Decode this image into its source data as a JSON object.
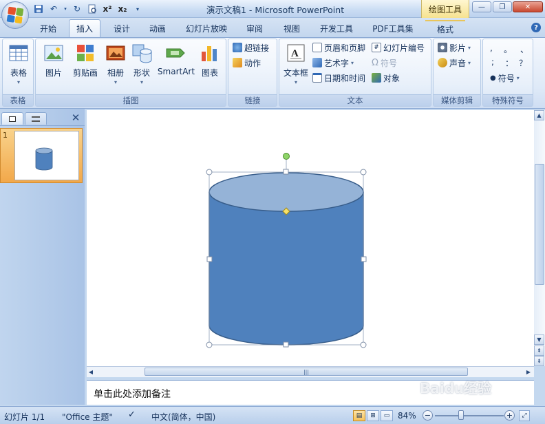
{
  "app": {
    "title": "演示文稿1 - Microsoft PowerPoint",
    "context_tab_group": "绘图工具",
    "window_buttons": {
      "minimize": "—",
      "restore": "❐",
      "close": "✕"
    }
  },
  "quick_access": [
    "save-icon",
    "undo-icon",
    "redo-icon",
    "print-preview-icon",
    "superscript-icon",
    "subscript-icon",
    "customize-icon"
  ],
  "quick_access_glyphs": {
    "x_super": "x²",
    "x_sub": "x₂"
  },
  "tabs": [
    {
      "label": "开始"
    },
    {
      "label": "插入"
    },
    {
      "label": "设计"
    },
    {
      "label": "动画"
    },
    {
      "label": "幻灯片放映"
    },
    {
      "label": "审阅"
    },
    {
      "label": "视图"
    },
    {
      "label": "开发工具"
    },
    {
      "label": "PDF工具集"
    },
    {
      "label": "格式"
    }
  ],
  "active_tab": "插入",
  "ribbon": {
    "groups": {
      "tables": {
        "label": "表格",
        "table": "表格"
      },
      "illustrations": {
        "label": "插图",
        "picture": "图片",
        "clipart": "剪贴画",
        "album": "相册",
        "shapes": "形状",
        "smartart": "SmartArt",
        "chart": "图表"
      },
      "links": {
        "label": "链接",
        "hyperlink": "超链接",
        "action": "动作"
      },
      "text": {
        "label": "文本",
        "textbox": "文本框",
        "header_footer": "页眉和页脚",
        "wordart": "艺术字",
        "datetime": "日期和时间",
        "slide_number": "幻灯片编号",
        "symbol": "符号",
        "object": "对象"
      },
      "media": {
        "label": "媒体剪辑",
        "movie": "影片",
        "sound": "声音"
      },
      "special_symbols": {
        "label": "特殊符号",
        "symbol": "符号",
        "punct": [
          ",",
          "。",
          "、",
          ";",
          "：",
          "？"
        ]
      }
    }
  },
  "slides_pane": {
    "slide_number": "1"
  },
  "notes": {
    "placeholder": "单击此处添加备注"
  },
  "statusbar": {
    "slide_info": "幻灯片 1/1",
    "theme": "\"Office 主题\"",
    "language": "中文(简体，中国)",
    "zoom": "84%"
  },
  "watermark": "Baidu经验",
  "colors": {
    "cylinder_fill": "#4f81bd",
    "cylinder_top": "#95b3d7",
    "cylinder_stroke": "#385d8a",
    "accent": "#2f68b5"
  }
}
